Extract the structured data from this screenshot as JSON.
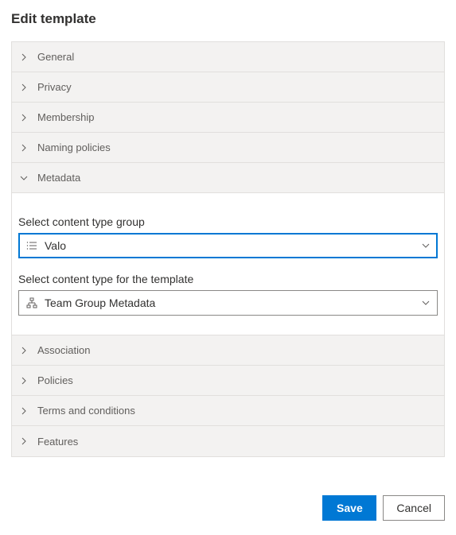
{
  "title": "Edit template",
  "sections": {
    "general": "General",
    "privacy": "Privacy",
    "membership": "Membership",
    "naming_policies": "Naming policies",
    "metadata": "Metadata",
    "association": "Association",
    "policies": "Policies",
    "terms": "Terms and conditions",
    "features": "Features"
  },
  "metadata_panel": {
    "group_label": "Select content type group",
    "group_value": "Valo",
    "type_label": "Select content type for the template",
    "type_value": "Team Group Metadata"
  },
  "footer": {
    "save": "Save",
    "cancel": "Cancel"
  }
}
